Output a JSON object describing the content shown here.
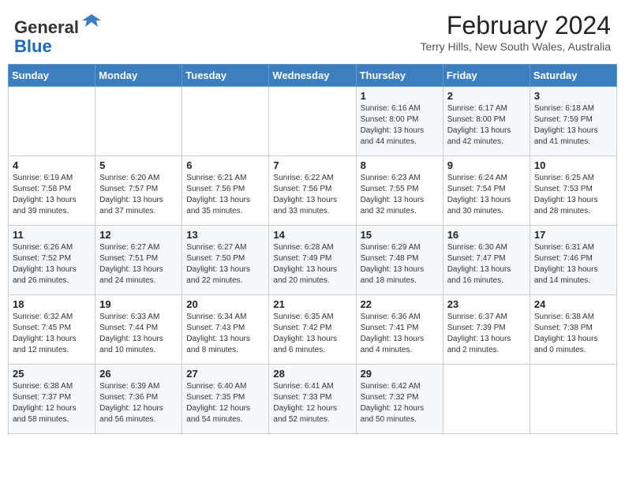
{
  "header": {
    "logo_line1": "General",
    "logo_line2": "Blue",
    "month_year": "February 2024",
    "location": "Terry Hills, New South Wales, Australia"
  },
  "days_of_week": [
    "Sunday",
    "Monday",
    "Tuesday",
    "Wednesday",
    "Thursday",
    "Friday",
    "Saturday"
  ],
  "weeks": [
    [
      {
        "day": "",
        "sunrise": "",
        "sunset": "",
        "daylight": ""
      },
      {
        "day": "",
        "sunrise": "",
        "sunset": "",
        "daylight": ""
      },
      {
        "day": "",
        "sunrise": "",
        "sunset": "",
        "daylight": ""
      },
      {
        "day": "",
        "sunrise": "",
        "sunset": "",
        "daylight": ""
      },
      {
        "day": "1",
        "sunrise": "6:16 AM",
        "sunset": "8:00 PM",
        "daylight": "13 hours and 44 minutes."
      },
      {
        "day": "2",
        "sunrise": "6:17 AM",
        "sunset": "8:00 PM",
        "daylight": "13 hours and 42 minutes."
      },
      {
        "day": "3",
        "sunrise": "6:18 AM",
        "sunset": "7:59 PM",
        "daylight": "13 hours and 41 minutes."
      }
    ],
    [
      {
        "day": "4",
        "sunrise": "6:19 AM",
        "sunset": "7:58 PM",
        "daylight": "13 hours and 39 minutes."
      },
      {
        "day": "5",
        "sunrise": "6:20 AM",
        "sunset": "7:57 PM",
        "daylight": "13 hours and 37 minutes."
      },
      {
        "day": "6",
        "sunrise": "6:21 AM",
        "sunset": "7:56 PM",
        "daylight": "13 hours and 35 minutes."
      },
      {
        "day": "7",
        "sunrise": "6:22 AM",
        "sunset": "7:56 PM",
        "daylight": "13 hours and 33 minutes."
      },
      {
        "day": "8",
        "sunrise": "6:23 AM",
        "sunset": "7:55 PM",
        "daylight": "13 hours and 32 minutes."
      },
      {
        "day": "9",
        "sunrise": "6:24 AM",
        "sunset": "7:54 PM",
        "daylight": "13 hours and 30 minutes."
      },
      {
        "day": "10",
        "sunrise": "6:25 AM",
        "sunset": "7:53 PM",
        "daylight": "13 hours and 28 minutes."
      }
    ],
    [
      {
        "day": "11",
        "sunrise": "6:26 AM",
        "sunset": "7:52 PM",
        "daylight": "13 hours and 26 minutes."
      },
      {
        "day": "12",
        "sunrise": "6:27 AM",
        "sunset": "7:51 PM",
        "daylight": "13 hours and 24 minutes."
      },
      {
        "day": "13",
        "sunrise": "6:27 AM",
        "sunset": "7:50 PM",
        "daylight": "13 hours and 22 minutes."
      },
      {
        "day": "14",
        "sunrise": "6:28 AM",
        "sunset": "7:49 PM",
        "daylight": "13 hours and 20 minutes."
      },
      {
        "day": "15",
        "sunrise": "6:29 AM",
        "sunset": "7:48 PM",
        "daylight": "13 hours and 18 minutes."
      },
      {
        "day": "16",
        "sunrise": "6:30 AM",
        "sunset": "7:47 PM",
        "daylight": "13 hours and 16 minutes."
      },
      {
        "day": "17",
        "sunrise": "6:31 AM",
        "sunset": "7:46 PM",
        "daylight": "13 hours and 14 minutes."
      }
    ],
    [
      {
        "day": "18",
        "sunrise": "6:32 AM",
        "sunset": "7:45 PM",
        "daylight": "13 hours and 12 minutes."
      },
      {
        "day": "19",
        "sunrise": "6:33 AM",
        "sunset": "7:44 PM",
        "daylight": "13 hours and 10 minutes."
      },
      {
        "day": "20",
        "sunrise": "6:34 AM",
        "sunset": "7:43 PM",
        "daylight": "13 hours and 8 minutes."
      },
      {
        "day": "21",
        "sunrise": "6:35 AM",
        "sunset": "7:42 PM",
        "daylight": "13 hours and 6 minutes."
      },
      {
        "day": "22",
        "sunrise": "6:36 AM",
        "sunset": "7:41 PM",
        "daylight": "13 hours and 4 minutes."
      },
      {
        "day": "23",
        "sunrise": "6:37 AM",
        "sunset": "7:39 PM",
        "daylight": "13 hours and 2 minutes."
      },
      {
        "day": "24",
        "sunrise": "6:38 AM",
        "sunset": "7:38 PM",
        "daylight": "13 hours and 0 minutes."
      }
    ],
    [
      {
        "day": "25",
        "sunrise": "6:38 AM",
        "sunset": "7:37 PM",
        "daylight": "12 hours and 58 minutes."
      },
      {
        "day": "26",
        "sunrise": "6:39 AM",
        "sunset": "7:36 PM",
        "daylight": "12 hours and 56 minutes."
      },
      {
        "day": "27",
        "sunrise": "6:40 AM",
        "sunset": "7:35 PM",
        "daylight": "12 hours and 54 minutes."
      },
      {
        "day": "28",
        "sunrise": "6:41 AM",
        "sunset": "7:33 PM",
        "daylight": "12 hours and 52 minutes."
      },
      {
        "day": "29",
        "sunrise": "6:42 AM",
        "sunset": "7:32 PM",
        "daylight": "12 hours and 50 minutes."
      },
      {
        "day": "",
        "sunrise": "",
        "sunset": "",
        "daylight": ""
      },
      {
        "day": "",
        "sunrise": "",
        "sunset": "",
        "daylight": ""
      }
    ]
  ],
  "labels": {
    "sunrise_prefix": "Sunrise: ",
    "sunset_prefix": "Sunset: ",
    "daylight_prefix": "Daylight: "
  }
}
